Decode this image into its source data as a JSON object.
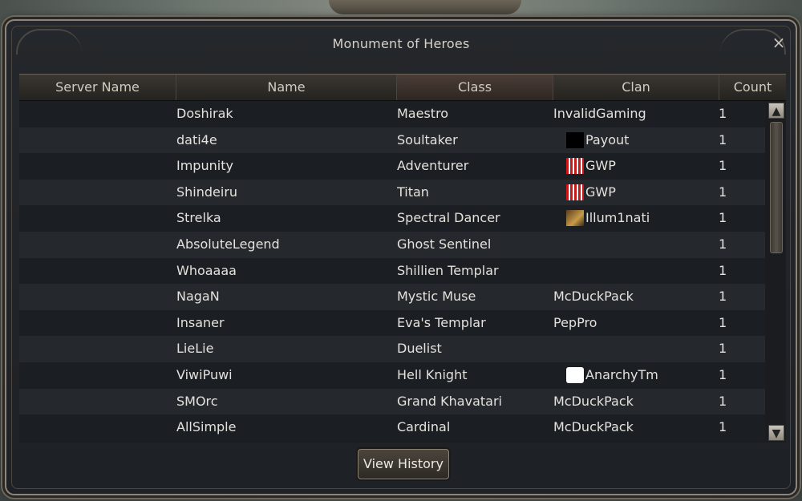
{
  "window": {
    "title": "Monument of Heroes",
    "close_glyph": "×"
  },
  "table": {
    "headers": [
      "Server Name",
      "Name",
      "Class",
      "Clan",
      "Count"
    ],
    "rows": [
      {
        "name": "Doshirak",
        "class": "Maestro",
        "clan": "InvalidGaming",
        "crest": "",
        "count": "1"
      },
      {
        "name": "dati4e",
        "class": "Soultaker",
        "clan": "Payout",
        "crest": "black",
        "count": "1"
      },
      {
        "name": "Impunity",
        "class": "Adventurer",
        "clan": "GWP",
        "crest": "red",
        "count": "1"
      },
      {
        "name": "Shindeiru",
        "class": "Titan",
        "clan": "GWP",
        "crest": "red",
        "count": "1"
      },
      {
        "name": "Strelka",
        "class": "Spectral Dancer",
        "clan": "Illum1nati",
        "crest": "brown",
        "count": "1"
      },
      {
        "name": "AbsoluteLegend",
        "class": "Ghost Sentinel",
        "clan": "",
        "crest": "",
        "count": "1"
      },
      {
        "name": "Whoaaaa",
        "class": "Shillien Templar",
        "clan": "",
        "crest": "",
        "count": "1"
      },
      {
        "name": "NagaN",
        "class": "Mystic Muse",
        "clan": "McDuckPack",
        "crest": "",
        "count": "1"
      },
      {
        "name": "Insaner",
        "class": "Eva's Templar",
        "clan": "PepPro",
        "crest": "",
        "count": "1"
      },
      {
        "name": "LieLie",
        "class": "Duelist",
        "clan": "",
        "crest": "",
        "count": "1"
      },
      {
        "name": "ViwiPuwi",
        "class": "Hell Knight",
        "clan": "AnarchyTm",
        "crest": "white",
        "count": "1"
      },
      {
        "name": "SMOrc",
        "class": "Grand Khavatari",
        "clan": "McDuckPack",
        "crest": "",
        "count": "1"
      },
      {
        "name": "AllSimple",
        "class": "Cardinal",
        "clan": "McDuckPack",
        "crest": "",
        "count": "1"
      }
    ]
  },
  "scrollbar": {
    "up_glyph": "▲",
    "down_glyph": "▼"
  },
  "buttons": {
    "view_history": "View History"
  },
  "colors": {
    "accent_header_active": "#4b3d36",
    "text": "#e4e2dc"
  }
}
